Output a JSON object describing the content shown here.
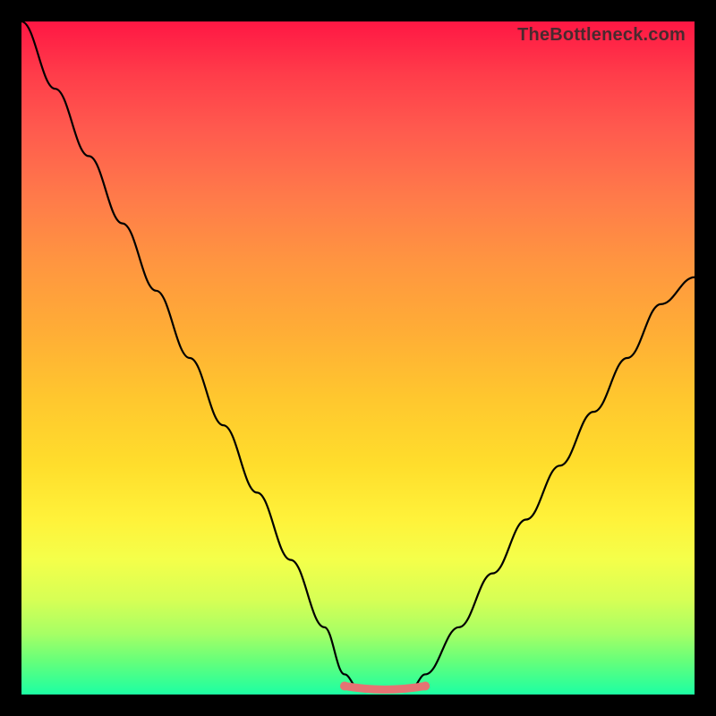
{
  "watermark": "TheBottleneck.com",
  "colors": {
    "curve": "#000000",
    "bottom_segment": "#e57373",
    "background_frame": "#000000"
  },
  "chart_data": {
    "type": "line",
    "title": "",
    "xlabel": "",
    "ylabel": "",
    "xlim": [
      0,
      100
    ],
    "ylim": [
      0,
      100
    ],
    "grid": false,
    "series": [
      {
        "name": "bottleneck-curve",
        "x": [
          0,
          5,
          10,
          15,
          20,
          25,
          30,
          35,
          40,
          45,
          48,
          50,
          52,
          55,
          58,
          60,
          65,
          70,
          75,
          80,
          85,
          90,
          95,
          100
        ],
        "y": [
          100,
          90,
          80,
          70,
          60,
          50,
          40,
          30,
          20,
          10,
          3,
          1,
          0.5,
          0.5,
          1,
          3,
          10,
          18,
          26,
          34,
          42,
          50,
          58,
          62
        ]
      }
    ],
    "annotations": [
      {
        "name": "bottom-band",
        "type": "segment",
        "x_range": [
          48,
          60
        ],
        "y": 1,
        "color": "#e57373"
      }
    ]
  }
}
